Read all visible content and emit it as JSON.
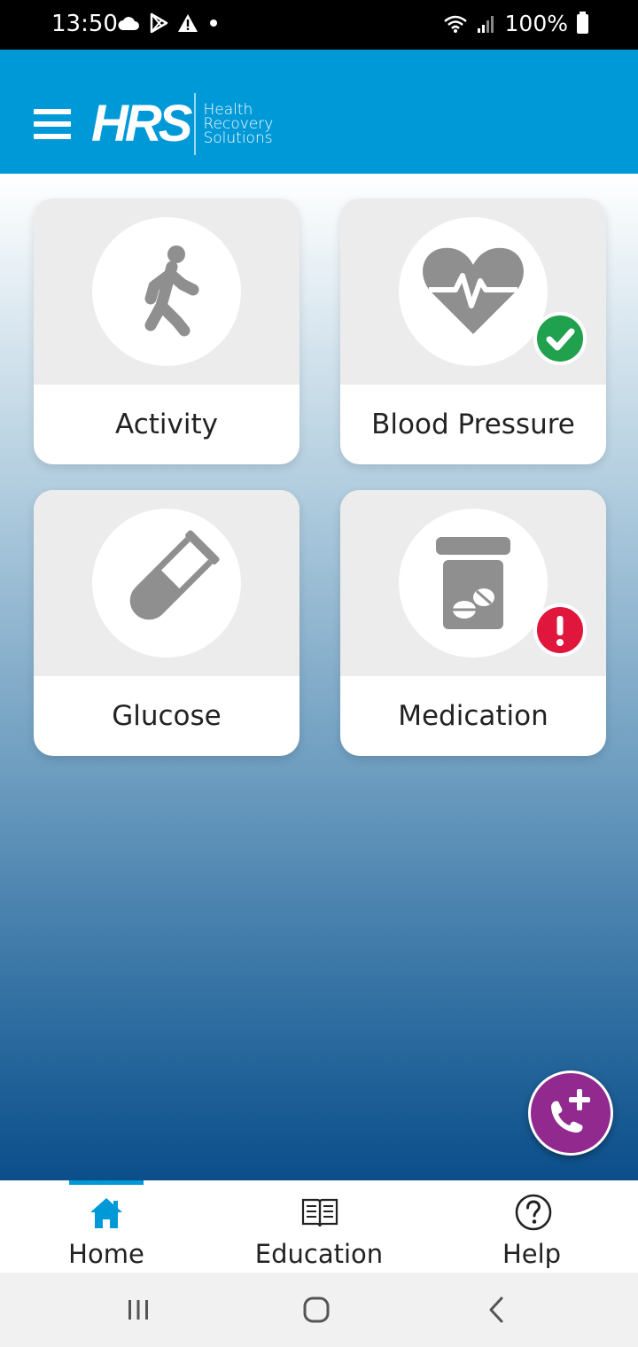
{
  "status_bar": {
    "time": "13:50",
    "battery": "100%",
    "icons": [
      "cloud-icon",
      "play-store-icon",
      "warning-icon",
      "dot-icon",
      "wifi-icon",
      "signal-icon",
      "battery-icon"
    ]
  },
  "header": {
    "logo_mark": "HRS",
    "logo_line1": "Health",
    "logo_line2": "Recovery",
    "logo_line3": "Solutions"
  },
  "tiles": [
    {
      "label": "Activity",
      "icon": "walking-person-icon",
      "status": "none"
    },
    {
      "label": "Blood Pressure",
      "icon": "heart-pulse-icon",
      "status": "complete"
    },
    {
      "label": "Glucose",
      "icon": "test-tube-icon",
      "status": "none"
    },
    {
      "label": "Medication",
      "icon": "pill-bottle-icon",
      "status": "alert"
    }
  ],
  "colors": {
    "brand_blue": "#0099d8",
    "success_green": "#1fa14d",
    "alert_red": "#e0163d",
    "fab_purple": "#92298e",
    "icon_gray": "#8f8f8f"
  },
  "bottom_nav": {
    "items": [
      {
        "label": "Home",
        "icon": "home-icon",
        "active": true
      },
      {
        "label": "Education",
        "icon": "book-icon",
        "active": false
      },
      {
        "label": "Help",
        "icon": "help-icon",
        "active": false
      }
    ]
  },
  "fab": {
    "icon": "phone-plus-icon"
  }
}
